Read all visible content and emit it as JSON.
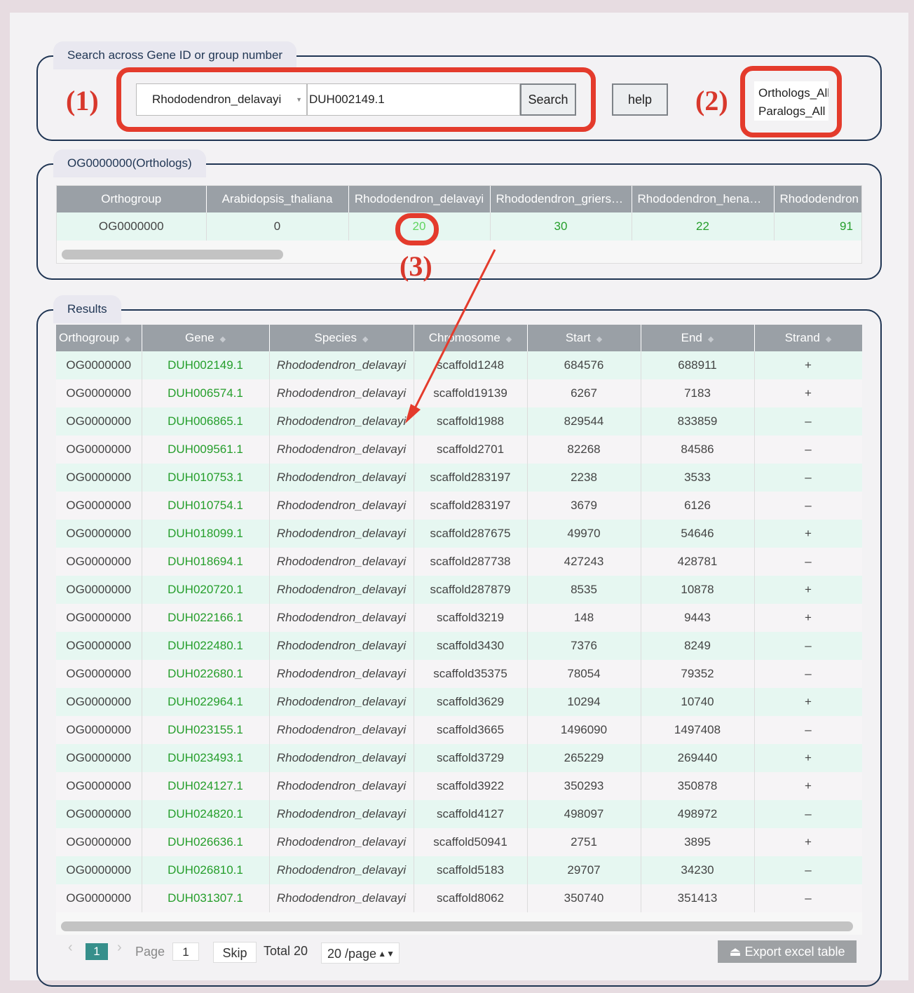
{
  "search_panel": {
    "legend": "Search across Gene ID or group number",
    "species_select": "Rhododendron_delavayi",
    "gene_input_value": "DUH002149.1",
    "search_button": "Search",
    "help_button": "help",
    "type_options": [
      "Orthologs_All",
      "Paralogs_All"
    ]
  },
  "annotations": {
    "label1": "(1)",
    "label2": "(2)",
    "label3": "(3)",
    "color": "#e43b2c"
  },
  "orthogroup_panel": {
    "legend": "OG0000000(Orthologs)",
    "headers": [
      "Orthogroup",
      "Arabidopsis_thaliana",
      "Rhododendron_delavayi",
      "Rhododendron_griersonianum",
      "Rhododendron_henanense",
      "Rhododendron"
    ],
    "row": [
      "OG0000000",
      "0",
      "20",
      "30",
      "22",
      "91"
    ]
  },
  "results_panel": {
    "legend": "Results",
    "headers": [
      "Orthogroup",
      "Gene",
      "Species",
      "Chromosome",
      "Start",
      "End",
      "Strand"
    ],
    "rows": [
      [
        "OG0000000",
        "DUH002149.1",
        "Rhododendron_delavayi",
        "scaffold1248",
        "684576",
        "688911",
        "+"
      ],
      [
        "OG0000000",
        "DUH006574.1",
        "Rhododendron_delavayi",
        "scaffold19139",
        "6267",
        "7183",
        "+"
      ],
      [
        "OG0000000",
        "DUH006865.1",
        "Rhododendron_delavayi",
        "scaffold1988",
        "829544",
        "833859",
        "–"
      ],
      [
        "OG0000000",
        "DUH009561.1",
        "Rhododendron_delavayi",
        "scaffold2701",
        "82268",
        "84586",
        "–"
      ],
      [
        "OG0000000",
        "DUH010753.1",
        "Rhododendron_delavayi",
        "scaffold283197",
        "2238",
        "3533",
        "–"
      ],
      [
        "OG0000000",
        "DUH010754.1",
        "Rhododendron_delavayi",
        "scaffold283197",
        "3679",
        "6126",
        "–"
      ],
      [
        "OG0000000",
        "DUH018099.1",
        "Rhododendron_delavayi",
        "scaffold287675",
        "49970",
        "54646",
        "+"
      ],
      [
        "OG0000000",
        "DUH018694.1",
        "Rhododendron_delavayi",
        "scaffold287738",
        "427243",
        "428781",
        "–"
      ],
      [
        "OG0000000",
        "DUH020720.1",
        "Rhododendron_delavayi",
        "scaffold287879",
        "8535",
        "10878",
        "+"
      ],
      [
        "OG0000000",
        "DUH022166.1",
        "Rhododendron_delavayi",
        "scaffold3219",
        "148",
        "9443",
        "+"
      ],
      [
        "OG0000000",
        "DUH022480.1",
        "Rhododendron_delavayi",
        "scaffold3430",
        "7376",
        "8249",
        "–"
      ],
      [
        "OG0000000",
        "DUH022680.1",
        "Rhododendron_delavayi",
        "scaffold35375",
        "78054",
        "79352",
        "–"
      ],
      [
        "OG0000000",
        "DUH022964.1",
        "Rhododendron_delavayi",
        "scaffold3629",
        "10294",
        "10740",
        "+"
      ],
      [
        "OG0000000",
        "DUH023155.1",
        "Rhododendron_delavayi",
        "scaffold3665",
        "1496090",
        "1497408",
        "–"
      ],
      [
        "OG0000000",
        "DUH023493.1",
        "Rhododendron_delavayi",
        "scaffold3729",
        "265229",
        "269440",
        "+"
      ],
      [
        "OG0000000",
        "DUH024127.1",
        "Rhododendron_delavayi",
        "scaffold3922",
        "350293",
        "350878",
        "+"
      ],
      [
        "OG0000000",
        "DUH024820.1",
        "Rhododendron_delavayi",
        "scaffold4127",
        "498097",
        "498972",
        "–"
      ],
      [
        "OG0000000",
        "DUH026636.1",
        "Rhododendron_delavayi",
        "scaffold50941",
        "2751",
        "3895",
        "+"
      ],
      [
        "OG0000000",
        "DUH026810.1",
        "Rhododendron_delavayi",
        "scaffold5183",
        "29707",
        "34230",
        "–"
      ],
      [
        "OG0000000",
        "DUH031307.1",
        "Rhododendron_delavayi",
        "scaffold8062",
        "350740",
        "351413",
        "–"
      ]
    ]
  },
  "pagination": {
    "prev": "‹",
    "current_page": "1",
    "next": "›",
    "page_label": "Page",
    "page_input": "1",
    "skip": "Skip",
    "total": "Total 20",
    "per_page": "20 /page",
    "export": "Export excel table"
  },
  "colors": {
    "gene_link": "#259e2b",
    "highlight_value": "#5fd45f",
    "header_bg": "#9aa0a6",
    "panel_border": "#1f3553",
    "row_odd": "#e6f7f1",
    "row_even": "#f6f4f6",
    "page_active": "#368f8b"
  }
}
